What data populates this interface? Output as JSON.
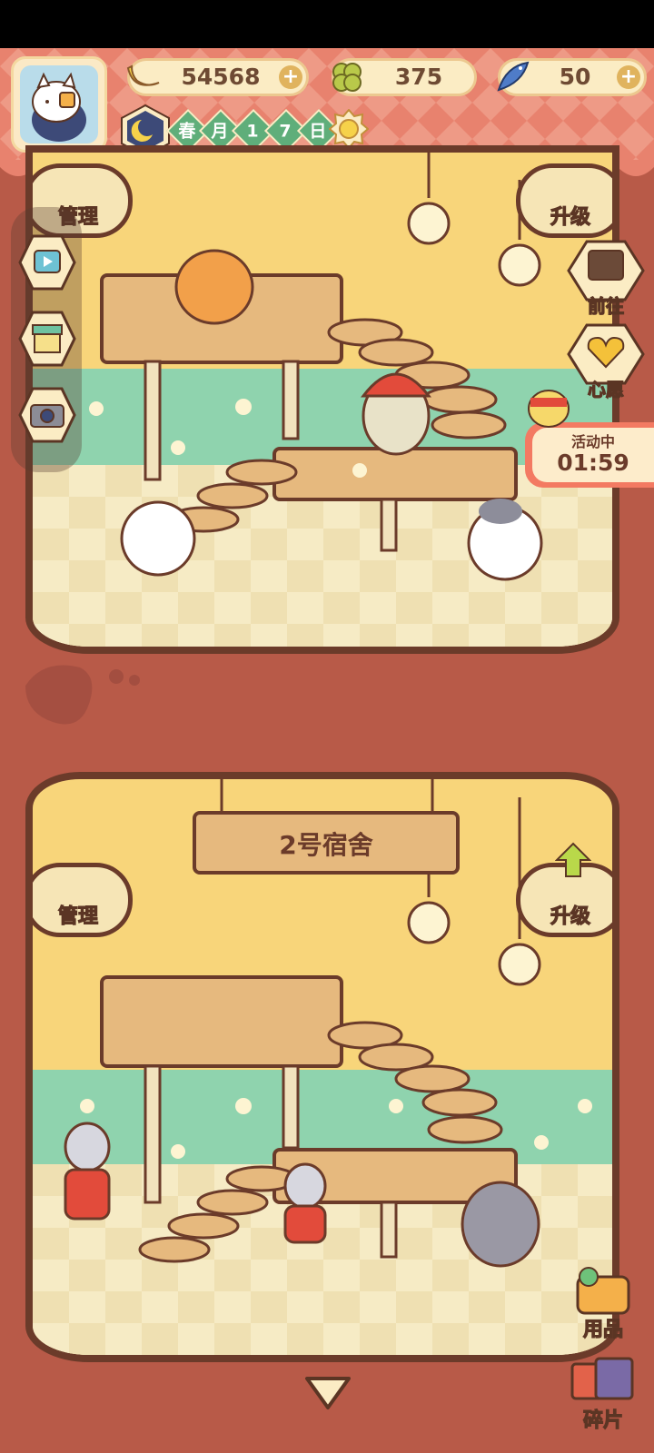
{
  "currency": {
    "banana": "54568",
    "clover": "375",
    "fish": "50"
  },
  "date": {
    "season": "春",
    "month_label": "月",
    "day1": "1",
    "day2": "7",
    "day_label": "日"
  },
  "room1": {
    "manage_label": "管理",
    "upgrade_label": "升级"
  },
  "room2": {
    "sign": "2号宿舍",
    "manage_label": "管理",
    "upgrade_label": "升级"
  },
  "right_menu": {
    "goto_label": "前往",
    "wish_label": "心愿"
  },
  "event": {
    "status": "活动中",
    "timer": "01:59"
  },
  "bottom_right": {
    "supplies_label": "用品",
    "fragments_label": "碎片"
  },
  "colors": {
    "hud": "#e8826e",
    "room_wall": "#f8d57a",
    "room_border": "#6b3b2a",
    "wainscot": "#8fd3ae",
    "background": "#b85a48"
  }
}
